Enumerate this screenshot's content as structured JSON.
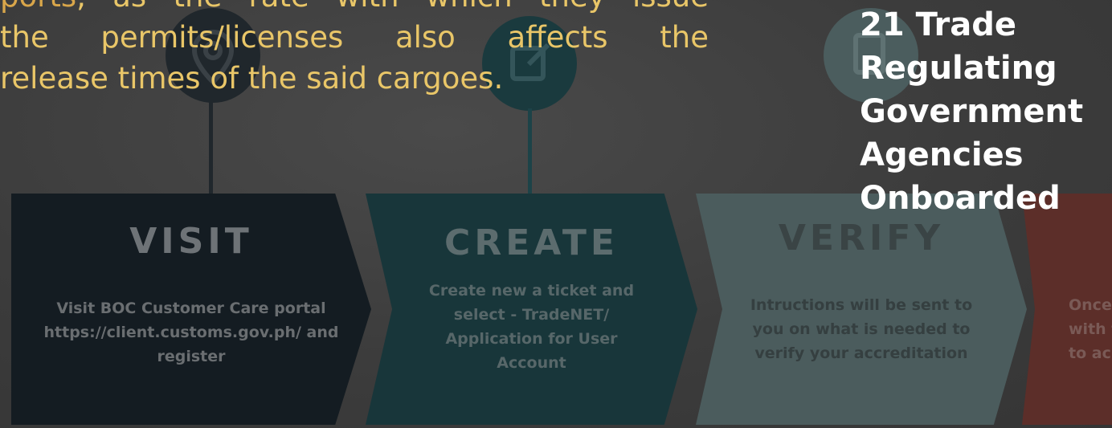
{
  "paragraph": {
    "line1_highlight": "ports",
    "line1_rest": ", as the rate with which they issue",
    "line2": "the permits/licenses also affects the",
    "line3": "release times of the said cargoes."
  },
  "stat": {
    "lines": [
      "21 Trade",
      "Regulating",
      "Government",
      "Agencies",
      "Onboarded"
    ]
  },
  "infographic": {
    "steps": [
      {
        "title": "VISIT",
        "description": "Visit BOC Customer Care portal\nhttps://client.customs.gov.ph/ and\nregister"
      },
      {
        "title": "CREATE",
        "description": "Create new a ticket and\nselect - TradeNET/\nApplication for User\nAccount"
      },
      {
        "title": "VERIFY",
        "description": "Intructions will be sent to\nyou on what is needed to\nverify your accreditation"
      },
      {
        "title": "",
        "description": "Once\nwith t\nto ac"
      }
    ],
    "icons": [
      "location-pin-icon",
      "edit-icon",
      "document-check-icon"
    ]
  },
  "colors": {
    "paragraph_text": "#e9c668",
    "stat_text": "#ffffff",
    "overlay": "#3e3e3e",
    "visit_bg": "#141c22",
    "create_bg": "#18363a",
    "verify_bg": "#4b5c5d",
    "next_bg": "#5c2e29"
  }
}
